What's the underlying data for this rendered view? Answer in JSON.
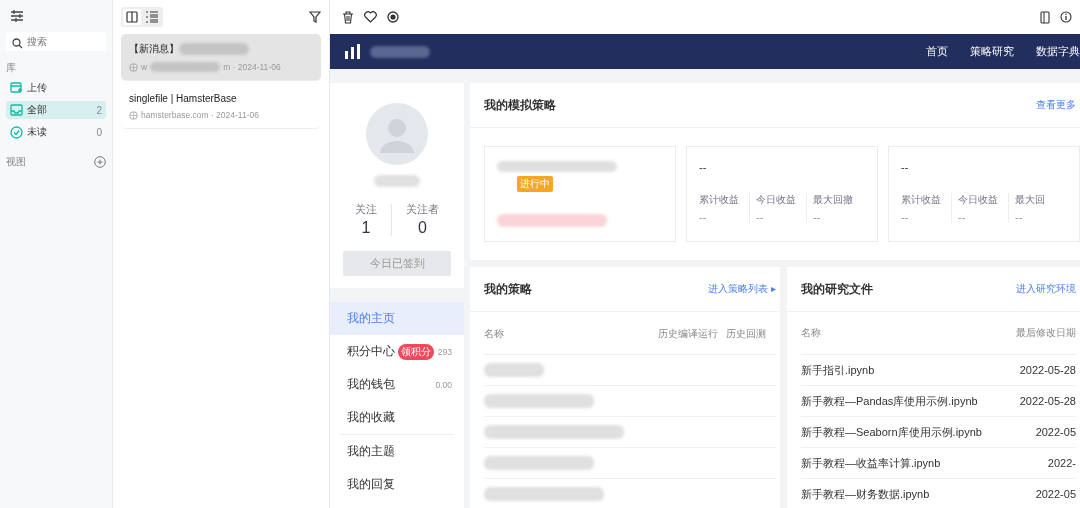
{
  "sidebar": {
    "search": {
      "placeholder": "搜索"
    },
    "library_label": "库",
    "items": [
      {
        "label": "上传",
        "selected": false,
        "kind": "upload"
      },
      {
        "label": "全部",
        "count": "2",
        "selected": true,
        "kind": "all"
      },
      {
        "label": "未读",
        "count": "0",
        "selected": false,
        "kind": "unread"
      }
    ],
    "views_label": "视图"
  },
  "list": {
    "items": [
      {
        "title": "【新消息】",
        "meta_start": "w",
        "meta_end": "m · 2024-11-06",
        "selected": true,
        "redacted": true
      },
      {
        "title": "singlefile | HamsterBase",
        "meta_start": "hamsterbase.com · 2024-11-06",
        "selected": false,
        "redacted": false
      }
    ]
  },
  "site": {
    "nav": [
      {
        "label": "首页"
      },
      {
        "label": "策略研究"
      },
      {
        "label": "数据字典"
      }
    ],
    "profile": {
      "stats": [
        {
          "label": "关注",
          "value": "1"
        },
        {
          "label": "关注者",
          "value": "0"
        }
      ],
      "checkin_button": "今日已签到"
    },
    "menu": [
      {
        "label": "我的主页",
        "selected": true
      },
      {
        "label": "积分中心",
        "selected": false,
        "badge": "领积分",
        "value": "293"
      },
      {
        "label": "我的钱包",
        "selected": false,
        "value": "0.00"
      },
      {
        "label": "我的收藏",
        "selected": false
      },
      {
        "label": "我的主题",
        "selected": false
      },
      {
        "label": "我的回复",
        "selected": false
      }
    ],
    "sim": {
      "title": "我的模拟策略",
      "more": "查看更多",
      "status": "进行中",
      "cards": [
        {
          "name": "--",
          "stats": [
            {
              "label": "累计收益",
              "value": "--"
            },
            {
              "label": "今日收益",
              "value": "--"
            },
            {
              "label": "最大回撤",
              "value": "--"
            }
          ]
        },
        {
          "name": "--",
          "stats": [
            {
              "label": "累计收益",
              "value": "--"
            },
            {
              "label": "今日收益",
              "value": "--"
            },
            {
              "label": "最大回",
              "value": "--"
            }
          ]
        }
      ]
    },
    "strategies": {
      "title": "我的策略",
      "link": "进入策略列表 ▸",
      "columns": [
        "名称",
        "历史编译运行",
        "历史回测"
      ]
    },
    "files": {
      "title": "我的研究文件",
      "link": "进入研究环境",
      "columns": [
        "名称",
        "最后修改日期"
      ],
      "rows": [
        {
          "name": "新手指引.ipynb",
          "date": "2022-05-28"
        },
        {
          "name": "新手教程—Pandas库使用示例.ipynb",
          "date": "2022-05-28"
        },
        {
          "name": "新手教程—Seaborn库使用示例.ipynb",
          "date": "2022-05"
        },
        {
          "name": "新手教程—收益率计算.ipynb",
          "date": "2022-"
        },
        {
          "name": "新手教程—财务数据.ipynb",
          "date": "2022-05"
        }
      ]
    }
  }
}
